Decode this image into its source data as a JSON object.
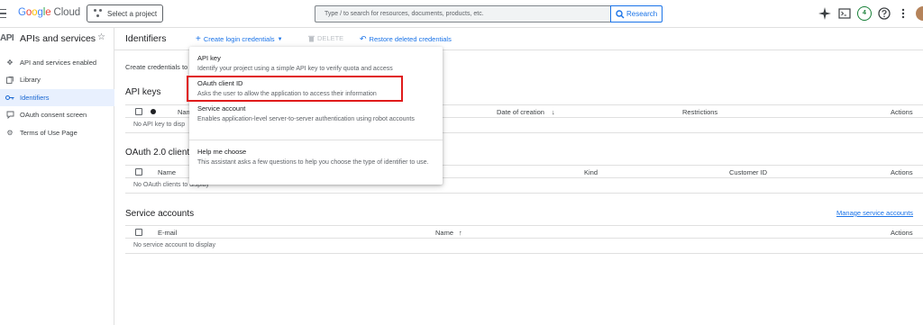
{
  "topbar": {
    "logo_letters": [
      "G",
      "o",
      "o",
      "g",
      "l",
      "e"
    ],
    "logo_cloud": "Cloud",
    "project_button": "Select a project",
    "search_placeholder": "Type / to search for resources, documents, products, etc.",
    "search_button": "Research",
    "badge_count": "4",
    "icons": [
      "sparkle-icon",
      "terminal-icon",
      "help-icon",
      "more-vert-icon"
    ]
  },
  "sidebar": {
    "badge": "API",
    "title": "APIs and services",
    "items": [
      {
        "label": "API and services enabled",
        "icon": "move-icon"
      },
      {
        "label": "Library",
        "icon": "library-icon"
      },
      {
        "label": "Identifiers",
        "icon": "key-icon",
        "active": true
      },
      {
        "label": "OAuth consent screen",
        "icon": "consent-icon"
      },
      {
        "label": "Terms of Use Page",
        "icon": "settings-icon"
      }
    ]
  },
  "main": {
    "title": "Identifiers",
    "create_label": "Create login credentials",
    "delete_label": "DELETE",
    "restore_label": "Restore deleted credentials",
    "description": "Create credentials to",
    "api_keys": {
      "title": "API keys",
      "headers": {
        "name": "Nam",
        "date": "Date of creation",
        "restrictions": "Restrictions",
        "actions": "Actions"
      },
      "empty": "No API key to disp"
    },
    "oauth": {
      "title": "OAuth 2.0 client",
      "headers": {
        "name": "Name",
        "kind": "Kind",
        "customer_id": "Customer ID",
        "actions": "Actions"
      },
      "empty": "No OAuth clients to display"
    },
    "service_accounts": {
      "title": "Service accounts",
      "manage": "Manage service accounts",
      "headers": {
        "email": "E-mail",
        "name": "Name",
        "actions": "Actions"
      },
      "empty": "No service account to display"
    }
  },
  "menu": {
    "items": [
      {
        "title": "API key",
        "desc": "Identify your project using a simple API key to verify quota and access"
      },
      {
        "title": "OAuth client ID",
        "desc": "Asks the user to allow the application to access their information"
      },
      {
        "title": "Service account",
        "desc": "Enables application-level server-to-server authentication using robot accounts"
      },
      {
        "title": "Help me choose",
        "desc": "This assistant asks a few questions to help you choose the type of identifier to use."
      }
    ]
  },
  "colors": {
    "accent": "#1a73e8",
    "highlight": "#e01b1b",
    "active_bg": "#e8f0fe"
  }
}
